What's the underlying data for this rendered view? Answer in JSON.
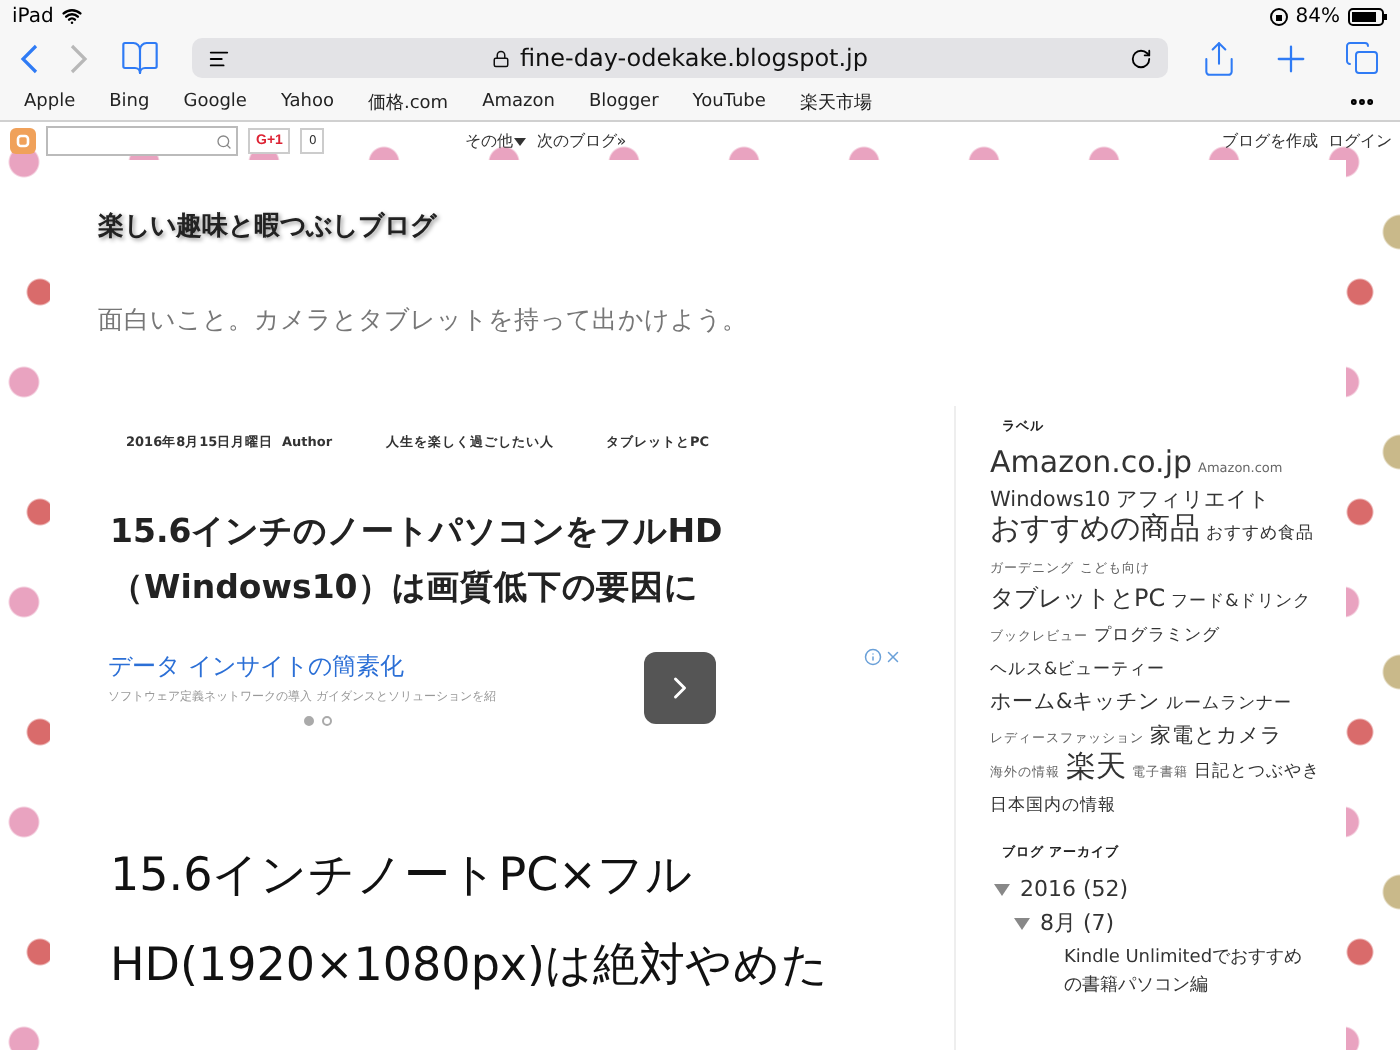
{
  "status_bar": {
    "device": "iPad",
    "battery": "84%"
  },
  "toolbar": {
    "back": {
      "disabled": false
    },
    "forward": {
      "disabled": true
    },
    "url": "fine-day-odekake.blogspot.jp"
  },
  "favorites": [
    "Apple",
    "Bing",
    "Google",
    "Yahoo",
    "価格.com",
    "Amazon",
    "Blogger",
    "YouTube",
    "楽天市場"
  ],
  "blogger_bar": {
    "gplus": "G+1",
    "count": "0",
    "more": "その他",
    "next": "次のブログ»",
    "create": "ブログを作成",
    "login": "ログイン"
  },
  "blog": {
    "title": "楽しい趣味と暇つぶしブログ",
    "tagline": "面白いこと。カメラとタブレットを持って出かけよう。"
  },
  "post": {
    "meta": [
      "2016年8月15日月曜日",
      "Author",
      "人生を楽しく過ごしたい人",
      "タブレットとPC"
    ],
    "title": "15.6インチのノートパソコンをフルHD（Windows10）は画質低下の要因に",
    "ad": {
      "headline": "データ インサイトの簡素化",
      "description": "ソフトウェア定義ネットワークの導入 ガイダンスとソリューションを紹",
      "dots": [
        {
          "selected": true
        },
        {
          "selected": false
        }
      ]
    },
    "heading": "15.6インチノートPC×フルHD(1920×1080px)は絶対やめた"
  },
  "sidebar": {
    "labels_title": "ラベル",
    "tags": [
      {
        "text": "Amazon.co.jp",
        "kind": "huge"
      },
      {
        "text": "Amazon.com",
        "kind": "tiny"
      },
      {
        "text": "Windows10",
        "kind": "medium"
      },
      {
        "text": "アフィリエイト",
        "kind": "medium"
      },
      {
        "text": "おすすめの商品",
        "kind": "huge"
      },
      {
        "text": "おすすめ食品",
        "kind": "small"
      },
      {
        "text": "ガーデニング",
        "kind": "tiny"
      },
      {
        "text": "こども向け",
        "kind": "tiny"
      },
      {
        "text": "タブレットとPC",
        "kind": "large"
      },
      {
        "text": "フード&ドリンク",
        "kind": "small"
      },
      {
        "text": "ブックレビュー",
        "kind": "tiny"
      },
      {
        "text": "プログラミング",
        "kind": "small"
      },
      {
        "text": "ヘルス&ビューティー",
        "kind": "small"
      },
      {
        "text": "ホーム&キッチン",
        "kind": "medium"
      },
      {
        "text": "ルームランナー",
        "kind": "small"
      },
      {
        "text": "レディースファッション",
        "kind": "tiny"
      },
      {
        "text": "家電とカメラ",
        "kind": "medium"
      },
      {
        "text": "海外の情報",
        "kind": "tiny"
      },
      {
        "text": "楽天",
        "kind": "huge"
      },
      {
        "text": "電子書籍",
        "kind": "tiny"
      },
      {
        "text": "日記とつぶやき",
        "kind": "small"
      },
      {
        "text": "日本国内の情報",
        "kind": "small"
      }
    ],
    "archive_title": "ブログ アーカイブ",
    "archive": [
      {
        "label": "2016 (52)",
        "expanded": true,
        "children": [
          {
            "label": "8月 (7)",
            "expanded": true,
            "children": [
              {
                "label": "Kindle Unlimitedでおすすめの書籍パソコン編"
              }
            ]
          }
        ]
      }
    ]
  }
}
